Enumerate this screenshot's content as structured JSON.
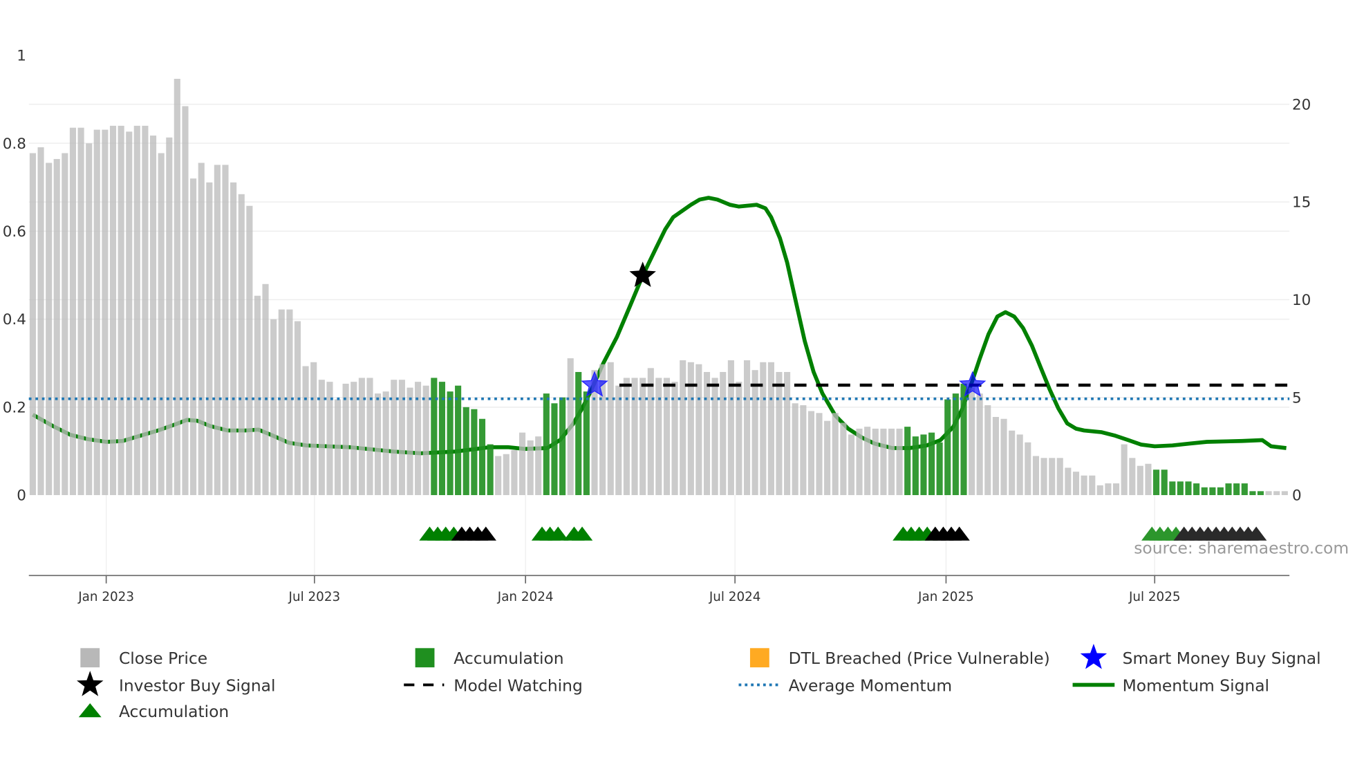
{
  "chart_data": {
    "type": "bar",
    "title": "",
    "source": "source: sharemaestro.com",
    "left_axis": {
      "ticks": [
        0,
        0.2,
        0.4,
        0.6,
        0.8,
        1
      ],
      "tick_labels": [
        "0",
        "0.2",
        "0.4",
        "0.6",
        "0.8",
        "1"
      ],
      "range": [
        0,
        1
      ]
    },
    "right_axis": {
      "ticks": [
        0,
        5,
        10,
        15,
        20
      ],
      "tick_labels": [
        "0",
        "5",
        "10",
        "15",
        "20"
      ],
      "range": [
        0,
        22.5
      ]
    },
    "x_axis": {
      "unit": "week index",
      "ticks": [
        9.15,
        35.1,
        61.4,
        87.5,
        113.8,
        139.8
      ],
      "tick_labels": [
        "Jan 2023",
        "Jul 2023",
        "Jan 2024",
        "Jul 2024",
        "Jan 2025",
        "Jul 2025"
      ]
    },
    "close_price": [
      17.5,
      17.8,
      17.0,
      17.2,
      17.5,
      18.8,
      18.8,
      18.0,
      18.7,
      18.7,
      18.9,
      18.9,
      18.6,
      18.9,
      18.9,
      18.4,
      17.5,
      18.3,
      21.3,
      19.9,
      16.2,
      17.0,
      16.0,
      16.9,
      16.9,
      16.0,
      15.4,
      14.8,
      10.2,
      10.8,
      9.0,
      9.5,
      9.5,
      8.9,
      6.6,
      6.8,
      5.9,
      5.8,
      4.9,
      5.7,
      5.8,
      6.0,
      6.0,
      5.2,
      5.3,
      5.9,
      5.9,
      5.5,
      5.8,
      5.6,
      6.0,
      5.8,
      5.3,
      5.6,
      4.5,
      4.4,
      3.9,
      2.6,
      2.0,
      2.1,
      2.3,
      3.2,
      2.8,
      3.0,
      5.2,
      4.7,
      5.0,
      7.0,
      6.3,
      5.3,
      6.4,
      6.7,
      6.8,
      5.6,
      6.0,
      6.0,
      6.0,
      6.5,
      6.0,
      6.0,
      5.8,
      6.9,
      6.8,
      6.7,
      6.3,
      6.0,
      6.3,
      6.9,
      5.8,
      6.9,
      6.4,
      6.8,
      6.8,
      6.3,
      6.3,
      4.7,
      4.6,
      4.3,
      4.2,
      3.8,
      4.2,
      3.7,
      3.1,
      3.4,
      3.5,
      3.4,
      3.4,
      3.4,
      3.4,
      3.5,
      3.0,
      3.1,
      3.2,
      2.7,
      4.9,
      5.2,
      5.7,
      5.5,
      5.2,
      4.6,
      4.0,
      3.9,
      3.3,
      3.1,
      2.7,
      2.0,
      1.9,
      1.9,
      1.9,
      1.4,
      1.2,
      1.0,
      1.0,
      0.5,
      0.6,
      0.6,
      2.6,
      1.9,
      1.5,
      1.6,
      1.3,
      1.3,
      0.7,
      0.7,
      0.7,
      0.6,
      0.4,
      0.4,
      0.4,
      0.6,
      0.6,
      0.6,
      0.2,
      0.2,
      0.2,
      0.2,
      0.2
    ],
    "accumulation_ranges": [
      [
        50,
        57
      ],
      [
        64,
        66
      ],
      [
        68,
        69
      ],
      [
        109,
        116
      ],
      [
        140,
        153
      ]
    ],
    "momentum_signal": {
      "x": [
        0,
        2.5,
        4.7,
        6.9,
        9.2,
        11.2,
        13.4,
        15.6,
        17.8,
        19.2,
        20.5,
        22.1,
        24.3,
        26.5,
        28.1,
        29.7,
        31.9,
        34.1,
        39.5,
        45,
        48.3,
        52.6,
        57,
        59.2,
        61.3,
        64.1,
        65.7,
        67.3,
        68.4,
        69.5,
        71.1,
        72.8,
        74.4,
        76,
        77.7,
        78.8,
        79.8,
        82,
        83.1,
        84.2,
        85.3,
        86.9,
        88,
        90.2,
        91.3,
        92,
        93.1,
        94,
        95.1,
        96.2,
        97.3,
        98.4,
        100,
        101.6,
        103.3,
        104.9,
        107.1,
        109.3,
        111.4,
        113.1,
        114.7,
        115.8,
        116.9,
        118,
        119.1,
        120.2,
        121.2,
        122.3,
        123.4,
        124.5,
        125.6,
        126.7,
        127.8,
        128.9,
        130,
        131,
        133.2,
        134.9,
        136.5,
        138.1,
        139.8,
        142,
        144.1,
        146.3,
        150.7,
        153.2,
        154.3,
        156.2
      ],
      "y": [
        0.183,
        0.157,
        0.137,
        0.127,
        0.121,
        0.123,
        0.135,
        0.147,
        0.161,
        0.171,
        0.169,
        0.157,
        0.147,
        0.147,
        0.149,
        0.137,
        0.119,
        0.113,
        0.109,
        0.099,
        0.095,
        0.099,
        0.109,
        0.109,
        0.105,
        0.107,
        0.125,
        0.161,
        0.195,
        0.235,
        0.3,
        0.36,
        0.429,
        0.499,
        0.563,
        0.604,
        0.632,
        0.66,
        0.672,
        0.676,
        0.672,
        0.66,
        0.656,
        0.66,
        0.652,
        0.632,
        0.584,
        0.529,
        0.439,
        0.35,
        0.28,
        0.231,
        0.181,
        0.151,
        0.131,
        0.117,
        0.107,
        0.107,
        0.113,
        0.125,
        0.155,
        0.195,
        0.25,
        0.31,
        0.366,
        0.406,
        0.416,
        0.406,
        0.38,
        0.34,
        0.29,
        0.241,
        0.197,
        0.163,
        0.151,
        0.147,
        0.143,
        0.135,
        0.125,
        0.115,
        0.111,
        0.113,
        0.117,
        0.121,
        0.123,
        0.125,
        0.111,
        0.107
      ]
    },
    "average_momentum": 0.219,
    "model_watching": {
      "value": 0.25,
      "from_x": 73.1
    },
    "smart_money_buy_signals": [
      {
        "x": 70,
        "y": 0.25
      },
      {
        "x": 117.1,
        "y": 0.25
      }
    ],
    "investor_buy_signals": [
      {
        "x": 76,
        "y": 0.499
      }
    ],
    "accumulation_markers": {
      "green": [
        50,
        51,
        52,
        53,
        64,
        65,
        66,
        68,
        69,
        109,
        110,
        111,
        112,
        140,
        141,
        142,
        143
      ],
      "black": [
        54,
        55,
        56,
        57,
        113,
        114,
        115,
        116,
        144,
        145,
        146,
        147,
        148,
        149,
        150,
        151,
        152,
        153
      ]
    },
    "legend": [
      {
        "label": "Close Price",
        "symbol": "square",
        "color": "#b8b8b8"
      },
      {
        "label": "Accumulation",
        "symbol": "square",
        "color": "#1f8f1f"
      },
      {
        "label": "DTL Breached (Price Vulnerable)",
        "symbol": "square",
        "color": "#ffaa22"
      },
      {
        "label": "Smart Money Buy Signal",
        "symbol": "star",
        "color": "#0000ff"
      },
      {
        "label": "Investor Buy Signal",
        "symbol": "star",
        "color": "#000000"
      },
      {
        "label": "Model Watching",
        "symbol": "dash",
        "color": "#000000"
      },
      {
        "label": "Average Momentum",
        "symbol": "dot",
        "color": "#1f77b4"
      },
      {
        "label": "Momentum Signal",
        "symbol": "line",
        "color": "#008000"
      },
      {
        "label": "Accumulation",
        "symbol": "triangle",
        "color": "#008000"
      }
    ],
    "legend_placement": "bottom"
  }
}
